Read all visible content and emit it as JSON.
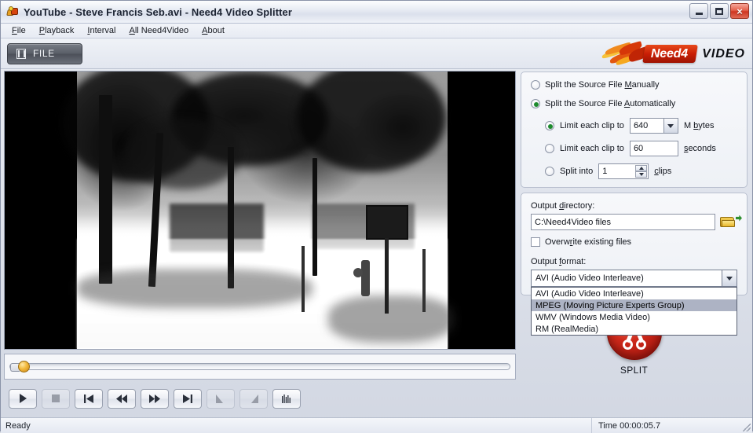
{
  "window": {
    "title": "YouTube - Steve Francis Seb.avi - Need4 Video Splitter",
    "minimize_label": "–",
    "maximize_label": "",
    "close_label": "×"
  },
  "menu": {
    "items": [
      {
        "accel": "F",
        "rest": "ile"
      },
      {
        "accel": "P",
        "rest": "layback"
      },
      {
        "accel": "I",
        "rest": "nterval"
      },
      {
        "accel": "A",
        "rest": "ll Need4Video"
      },
      {
        "accel": "A",
        "rest": "bout"
      }
    ]
  },
  "toolbar": {
    "file_button_label": "FILE",
    "logo_brand": "Need4",
    "logo_word": "VIDEO"
  },
  "split_options": {
    "manual": {
      "accel_pre": "Split the Source File ",
      "accel": "M",
      "accel_post": "anually",
      "selected": false
    },
    "automatic": {
      "accel_pre": "Split the Source File ",
      "accel": "A",
      "accel_post": "utomatically",
      "selected": true
    },
    "by_size": {
      "label": "Limit each clip to",
      "value": "640",
      "unit_pre": "M ",
      "unit_accel": "b",
      "unit_post": "ytes",
      "selected": true
    },
    "by_time": {
      "label": "Limit each clip to",
      "value": "60",
      "unit_accel": "s",
      "unit_post": "econds",
      "selected": false
    },
    "by_count": {
      "label": "Split into",
      "value": "1",
      "unit_accel": "c",
      "unit_post": "lips",
      "selected": false
    }
  },
  "output": {
    "directory_label_pre": "Output ",
    "directory_label_accel": "d",
    "directory_label_post": "irectory:",
    "directory_value": "C:\\Need4Video files",
    "browse_icon": "folder-open-icon",
    "overwrite_label_pre": "Overw",
    "overwrite_label_accel": "r",
    "overwrite_label_post": "ite existing files",
    "overwrite_checked": false,
    "format_label_pre": "Output ",
    "format_label_accel": "f",
    "format_label_post": "ormat:",
    "format_selected": "AVI (Audio Video Interleave)",
    "format_options": [
      {
        "label": "AVI (Audio Video Interleave)",
        "highlighted": false
      },
      {
        "label": "MPEG (Moving Picture Experts Group)",
        "highlighted": true
      },
      {
        "label": "WMV (Windows Media Video)",
        "highlighted": false
      },
      {
        "label": "RM (RealMedia)",
        "highlighted": false
      }
    ],
    "dropdown_open": true
  },
  "split_action": {
    "label": "SPLIT",
    "icon": "scissors-icon",
    "color": "#cf2a1c"
  },
  "transport": {
    "buttons": [
      {
        "name": "play-button",
        "icon": "play-icon",
        "enabled": true
      },
      {
        "name": "stop-button",
        "icon": "stop-icon",
        "enabled": false
      },
      {
        "name": "first-frame-button",
        "icon": "skip-to-start-icon",
        "enabled": true
      },
      {
        "name": "rewind-button",
        "icon": "rewind-icon",
        "enabled": true
      },
      {
        "name": "fast-forward-button",
        "icon": "fast-forward-icon",
        "enabled": true
      },
      {
        "name": "last-frame-button",
        "icon": "skip-to-end-icon",
        "enabled": true
      },
      {
        "name": "mark-start-button",
        "icon": "mark-start-icon",
        "enabled": false
      },
      {
        "name": "mark-end-button",
        "icon": "mark-end-icon",
        "enabled": false
      },
      {
        "name": "waveform-button",
        "icon": "waveform-icon",
        "enabled": true
      }
    ]
  },
  "seek": {
    "position_percent": 2
  },
  "statusbar": {
    "status_text": "Ready",
    "time_text": "Time 00:00:05.7"
  }
}
